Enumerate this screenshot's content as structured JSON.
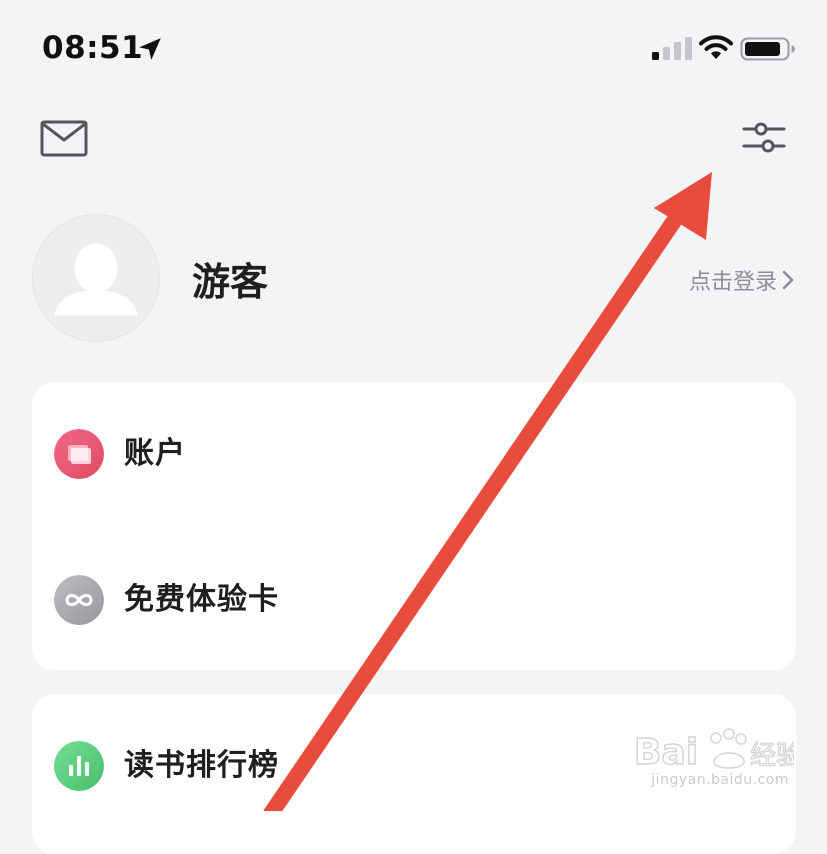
{
  "status_bar": {
    "time": "08:51",
    "icons": [
      "location-arrow-icon",
      "signal-icon",
      "wifi-icon",
      "battery-icon"
    ]
  },
  "header": {
    "left_icon": "mail-icon",
    "right_icon": "settings-sliders-icon"
  },
  "profile": {
    "avatar_icon": "default-avatar-icon",
    "name": "游客",
    "login_label": "点击登录"
  },
  "menu": {
    "group1": [
      {
        "label": "账户",
        "icon": "account-icon",
        "color": "#e8546e"
      },
      {
        "label": "免费体验卡",
        "icon": "infinity-icon",
        "color": "#a9a9ad"
      }
    ],
    "group2": [
      {
        "label": "读书排行榜",
        "icon": "ranking-chart-icon",
        "color": "#5ccf7f"
      }
    ]
  },
  "annotation": {
    "arrow_color": "#e84c3d"
  },
  "watermark": {
    "text": "jingyan.baidu.com"
  },
  "colors": {
    "background": "#f3f4f6",
    "card": "#ffffff",
    "text_primary": "#1f1f22",
    "text_secondary": "#8e8f94"
  }
}
